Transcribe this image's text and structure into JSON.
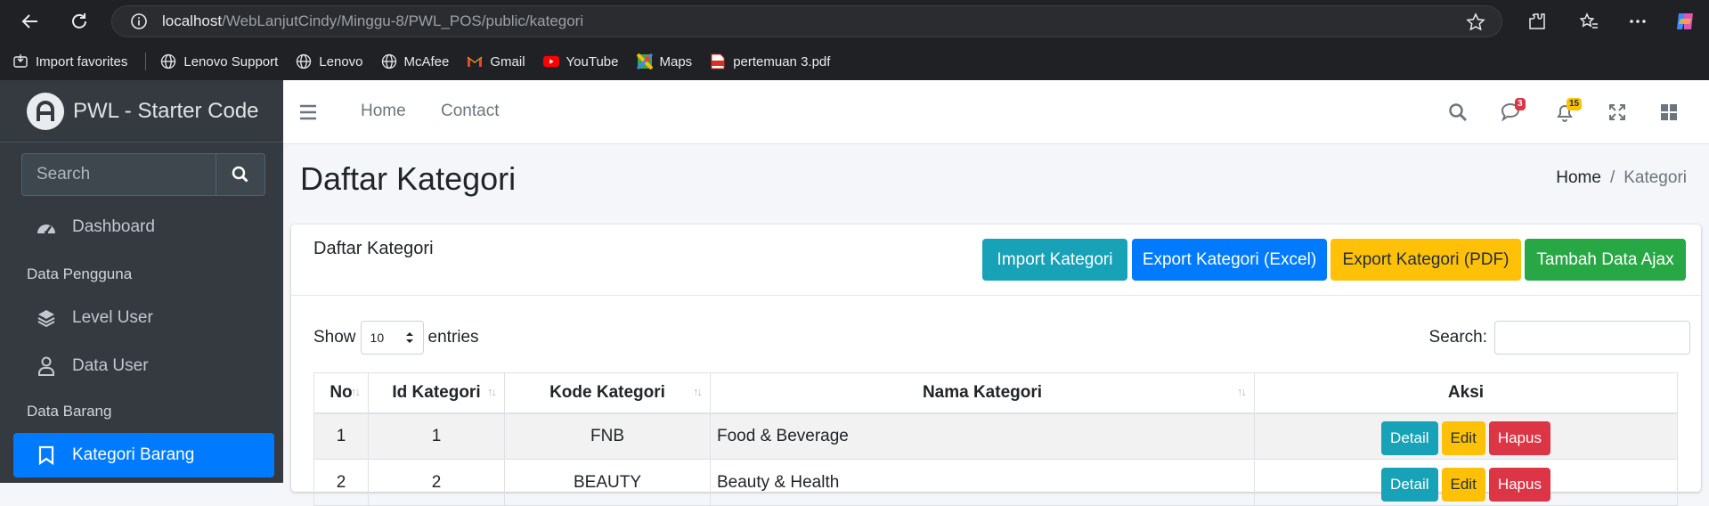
{
  "browser": {
    "url_host": "localhost",
    "url_path": "/WebLanjutCindy/Minggu-8/PWL_POS/public/kategori",
    "bookmarks": [
      {
        "label": "Import favorites",
        "icon": "import-icon"
      },
      {
        "label": "Lenovo Support",
        "icon": "globe-icon"
      },
      {
        "label": "Lenovo",
        "icon": "globe-icon"
      },
      {
        "label": "McAfee",
        "icon": "globe-icon"
      },
      {
        "label": "Gmail",
        "icon": "gmail-icon"
      },
      {
        "label": "YouTube",
        "icon": "youtube-icon"
      },
      {
        "label": "Maps",
        "icon": "maps-icon"
      },
      {
        "label": "pertemuan 3.pdf",
        "icon": "pdf-icon"
      }
    ]
  },
  "sidebar": {
    "brand": "PWL - Starter Code",
    "search_placeholder": "Search",
    "dashboard": "Dashboard",
    "head_pengguna": "Data Pengguna",
    "level_user": "Level User",
    "data_user": "Data User",
    "head_barang": "Data Barang",
    "kategori_barang": "Kategori Barang"
  },
  "topnav": {
    "home": "Home",
    "contact": "Contact",
    "messages_count": "3",
    "notifications_count": "15"
  },
  "page": {
    "title": "Daftar Kategori",
    "breadcrumb_home": "Home",
    "breadcrumb_sep": "/",
    "breadcrumb_current": "Kategori"
  },
  "card": {
    "title": "Daftar Kategori",
    "btn_import": "Import Kategori",
    "btn_export_excel": "Export Kategori (Excel)",
    "btn_export_pdf": "Export Kategori (PDF)",
    "btn_tambah": "Tambah Data Ajax"
  },
  "datatable": {
    "show_label": "Show",
    "entries_value": "10",
    "entries_label": "entries",
    "search_label": "Search:",
    "headers": [
      "No",
      "Id Kategori",
      "Kode Kategori",
      "Nama Kategori",
      "Aksi"
    ],
    "rows": [
      {
        "no": "1",
        "id": "1",
        "kode": "FNB",
        "nama": "Food & Beverage"
      },
      {
        "no": "2",
        "id": "2",
        "kode": "BEAUTY",
        "nama": "Beauty & Health"
      }
    ],
    "btn_detail": "Detail",
    "btn_edit": "Edit",
    "btn_hapus": "Hapus"
  },
  "colors": {
    "primary": "#007bff",
    "info": "#17a2b8",
    "warning": "#ffc107",
    "success": "#28a745",
    "danger": "#dc3545",
    "sidebar_bg": "#343a40"
  }
}
